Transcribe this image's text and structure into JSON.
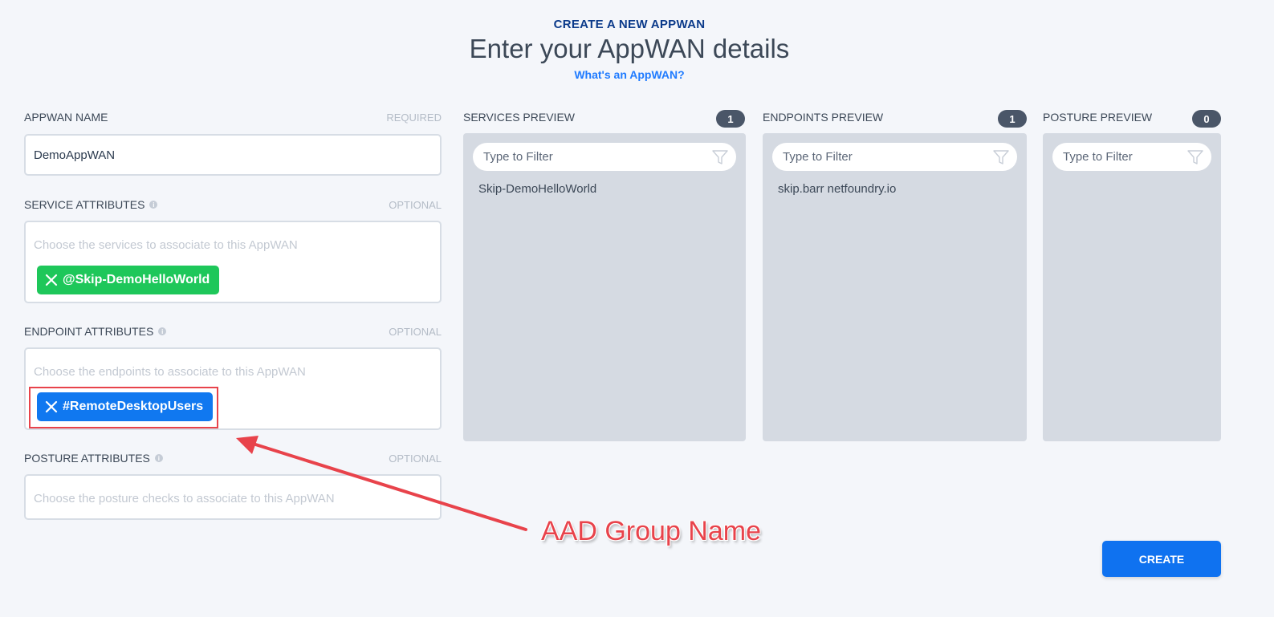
{
  "header": {
    "kicker": "CREATE A NEW APPWAN",
    "title": "Enter your AppWAN details",
    "help_link": "What's an AppWAN?"
  },
  "form": {
    "name": {
      "label": "APPWAN NAME",
      "meta": "REQUIRED",
      "value": "DemoAppWAN"
    },
    "services": {
      "label": "SERVICE ATTRIBUTES",
      "meta": "OPTIONAL",
      "placeholder": "Choose the services to associate to this AppWAN",
      "chips": [
        {
          "label": "@Skip-DemoHelloWorld",
          "color": "#1ec75a"
        }
      ]
    },
    "endpoints": {
      "label": "ENDPOINT ATTRIBUTES",
      "meta": "OPTIONAL",
      "placeholder": "Choose the endpoints to associate to this AppWAN",
      "chips": [
        {
          "label": "#RemoteDesktopUsers",
          "color": "#1078f0"
        }
      ]
    },
    "posture": {
      "label": "POSTURE ATTRIBUTES",
      "meta": "OPTIONAL",
      "placeholder": "Choose the posture checks to associate to this AppWAN"
    }
  },
  "previews": [
    {
      "label": "SERVICES PREVIEW",
      "count": "1",
      "filter_placeholder": "Type to Filter",
      "items": [
        "Skip-DemoHelloWorld"
      ]
    },
    {
      "label": "ENDPOINTS PREVIEW",
      "count": "1",
      "filter_placeholder": "Type to Filter",
      "items": [
        "skip.barr netfoundry.io"
      ]
    },
    {
      "label": "POSTURE PREVIEW",
      "count": "0",
      "filter_placeholder": "Type to Filter",
      "items": []
    }
  ],
  "actions": {
    "create_label": "CREATE"
  },
  "annotation": {
    "text": "AAD Group Name",
    "color": "#e8434b"
  },
  "icons": {
    "info": "info-icon",
    "remove": "close-icon",
    "filter": "funnel-icon"
  },
  "info_glyph": "i"
}
